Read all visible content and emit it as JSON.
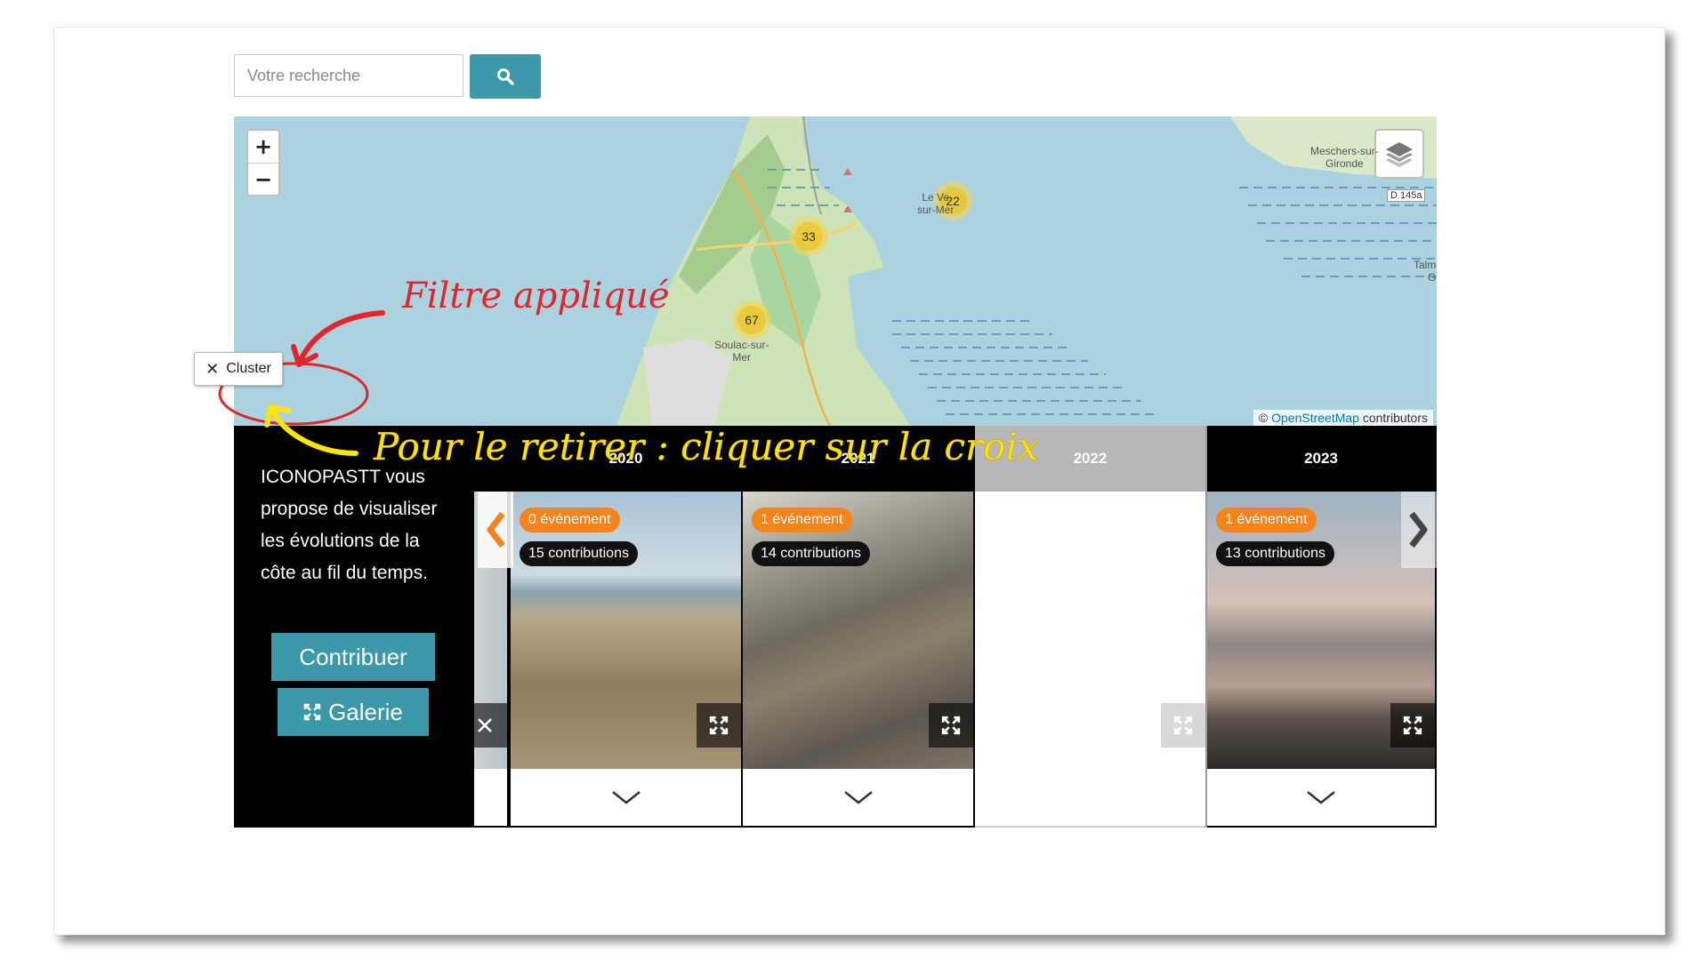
{
  "search": {
    "placeholder": "Votre recherche"
  },
  "map": {
    "zoom_in": "+",
    "zoom_out": "−",
    "attribution_prefix": "© ",
    "attribution_link": "OpenStreetMap",
    "attribution_suffix": " contributors",
    "clusters": [
      {
        "count": "22"
      },
      {
        "count": "33"
      },
      {
        "count": "67"
      }
    ],
    "labels": {
      "meschers": "Meschers-sur-\nGironde",
      "levedon": "Le Ve\nsur-Mer",
      "soulac": "Soulac-sur-\nMer",
      "talmont": "Talmo\nGir",
      "road": "D 145a"
    }
  },
  "filter_chip": {
    "label": "Cluster"
  },
  "annotations": {
    "filter_applied": "Filtre appliqué",
    "remove_hint": "Pour le retirer : cliquer sur la croix"
  },
  "intro": {
    "text": "ICONOPASTT vous propose de visualiser les évolutions de la côte au fil du temps.",
    "contribute_label": "Contribuer",
    "gallery_label": "Galerie"
  },
  "years": [
    {
      "year": "2020",
      "events": "0 événement",
      "contributions": "15 contributions"
    },
    {
      "year": "2021",
      "events": "1 événement",
      "contributions": "14 contributions"
    },
    {
      "year": "2022",
      "events": "",
      "contributions": ""
    },
    {
      "year": "2023",
      "events": "1 événement",
      "contributions": "13 contributions"
    }
  ],
  "colors": {
    "accent": "#3a98a8",
    "event_badge": "#f7831b",
    "annotation_red": "#e0262c",
    "annotation_yellow": "#ffe600"
  }
}
